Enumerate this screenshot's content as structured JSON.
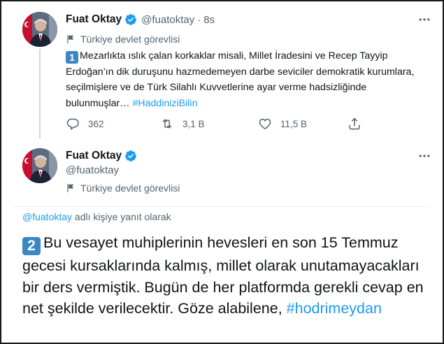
{
  "tweet1": {
    "author_name": "Fuat Oktay",
    "handle": "@fuatoktay",
    "separator": "·",
    "time": "8s",
    "account_label": "Türkiye devlet görevlisi",
    "badge_number": "1",
    "text": "Mezarlıkta ıslık çalan korkaklar misali, Millet İradesini ve Recep Tayyip Erdoğan’ın dik duruşunu hazmedemeyen darbe seviciler demokratik kurumlara, seçilmişlere ve de Türk Silahlı Kuvvetlerine ayar verme hadsizliğinde bulunmuşlar… ",
    "hashtag": "#HaddiniziBilin",
    "actions": {
      "reply_count": "362",
      "retweet_count": "3,1 B",
      "like_count": "11,5 B"
    }
  },
  "tweet2": {
    "author_name": "Fuat Oktay",
    "handle": "@fuatoktay",
    "account_label": "Türkiye devlet görevlisi",
    "reply_to_mention": "@fuatoktay",
    "reply_to_suffix": " adlı kişiye yanıt olarak",
    "badge_number": "2",
    "text": "Bu vesayet muhiplerinin hevesleri en son 15 Temmuz gecesi kursaklarında kalmış, millet olarak unutamayacakları bir ders vermiştik. Bugün de her platformda gerekli cevap en net şekilde verilecektir. Göze alabilene, ",
    "hashtag": "#hodrimeydan"
  },
  "icons": {
    "verified": "verified-badge-icon",
    "flag": "government-label-icon",
    "more": "more-options-icon",
    "reply": "reply-icon",
    "retweet": "retweet-icon",
    "like": "like-icon",
    "share": "share-icon"
  },
  "colors": {
    "link": "#1d9bf0",
    "secondary_text": "#536471",
    "badge_blue": "#3b88c3",
    "primary_text": "#0f1419"
  }
}
